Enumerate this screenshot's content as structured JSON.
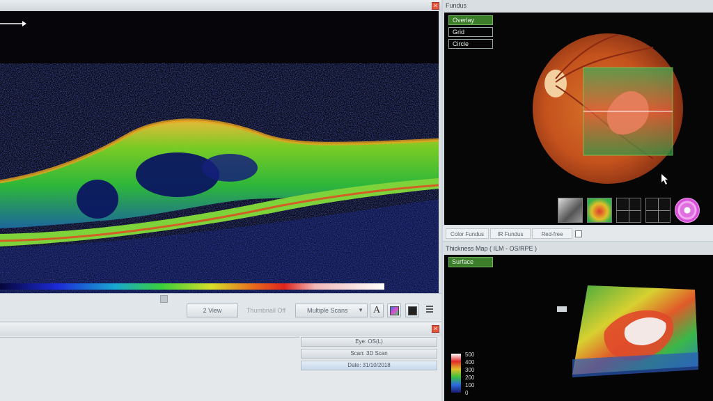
{
  "fundus_panel": {
    "title": "Fundus",
    "options": [
      "Overlay",
      "Grid",
      "Circle"
    ],
    "active_option": "Overlay",
    "tabs": [
      "Color Fundus",
      "IR Fundus",
      "Red-free"
    ]
  },
  "thickness_panel": {
    "title": "Thickness Map   ( ILM - OS/RPE )",
    "surface_label": "Surface",
    "scale_labels": [
      "500",
      "400",
      "300",
      "200",
      "100",
      "0"
    ]
  },
  "bscan_toolbar": {
    "view_button": "2 View",
    "thumbnail_button": "Thumbnail Off",
    "scans_select": "Multiple Scans",
    "text_tool": "A"
  },
  "scan_info": {
    "eye": "Eye: OS(L)",
    "scan": "Scan: 3D Scan",
    "date": "Date: 31/10/2018"
  },
  "colors": {
    "active_green": "#3c7d2a",
    "close_red": "#e2583a",
    "panel_bg": "#d8dee2"
  }
}
